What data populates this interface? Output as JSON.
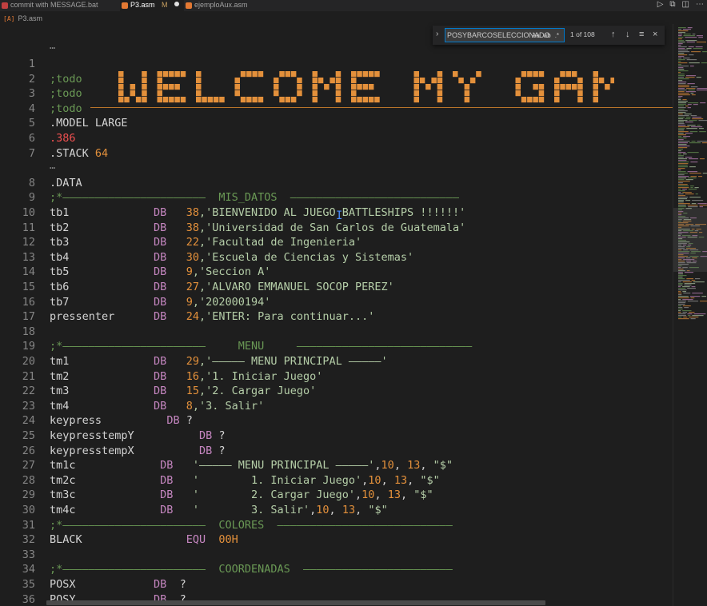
{
  "tabs": [
    {
      "label": "commit with MESSAGE.bat",
      "active": false
    },
    {
      "label": "P3.asm",
      "active": true,
      "modified": "M"
    },
    {
      "label": "ejemploAux.asm",
      "active": false
    }
  ],
  "breadcrumb": {
    "file": "P3.asm"
  },
  "find": {
    "query": "POSYBARCOSELECCIONADO",
    "match_case": "Aa",
    "whole_word": "ab",
    "regex": ".*",
    "count": "1 of 108"
  },
  "banner_text": "WELCOME MY GAME",
  "folds": {
    "top": "…",
    "after7": "…"
  },
  "lines": [
    {
      "n": "1",
      "tokens": []
    },
    {
      "n": "2",
      "tokens": [
        {
          "t": ";todo",
          "c": "c-cmt"
        }
      ]
    },
    {
      "n": "3",
      "tokens": [
        {
          "t": ";todo",
          "c": "c-cmt"
        }
      ]
    },
    {
      "n": "4",
      "tokens": [
        {
          "t": ";todo",
          "c": "c-cmt"
        }
      ]
    },
    {
      "n": "5",
      "tokens": [
        {
          "t": ".MODEL LARGE",
          "c": "c-plain"
        }
      ]
    },
    {
      "n": "6",
      "tokens": [
        {
          "t": ".386",
          "c": "c-red"
        }
      ]
    },
    {
      "n": "7",
      "tokens": [
        {
          "t": ".STACK ",
          "c": "c-plain"
        },
        {
          "t": "64",
          "c": "c-num"
        }
      ]
    },
    {
      "n": "8",
      "tokens": [
        {
          "t": ".DATA",
          "c": "c-plain"
        }
      ]
    },
    {
      "n": "9",
      "tokens": [
        {
          "t": ";*——————————————————————  MIS_DATOS  ——————————————————————————",
          "c": "c-cmt"
        }
      ]
    },
    {
      "n": "10",
      "tokens": [
        {
          "t": "tb1             ",
          "c": "c-plain"
        },
        {
          "t": "DB",
          "c": "c-kw"
        },
        {
          "t": "   ",
          "c": "c-plain"
        },
        {
          "t": "38",
          "c": "c-num"
        },
        {
          "t": ",'BIENVENIDO AL JUEGO BATTLESHIPS !!!!!!'",
          "c": "c-grn"
        }
      ]
    },
    {
      "n": "11",
      "tokens": [
        {
          "t": "tb2             ",
          "c": "c-plain"
        },
        {
          "t": "DB",
          "c": "c-kw"
        },
        {
          "t": "   ",
          "c": "c-plain"
        },
        {
          "t": "38",
          "c": "c-num"
        },
        {
          "t": ",'Universidad de San Carlos de Guatemala'",
          "c": "c-grn"
        }
      ]
    },
    {
      "n": "12",
      "tokens": [
        {
          "t": "tb3             ",
          "c": "c-plain"
        },
        {
          "t": "DB",
          "c": "c-kw"
        },
        {
          "t": "   ",
          "c": "c-plain"
        },
        {
          "t": "22",
          "c": "c-num"
        },
        {
          "t": ",'Facultad de Ingenieria'",
          "c": "c-grn"
        }
      ]
    },
    {
      "n": "13",
      "tokens": [
        {
          "t": "tb4             ",
          "c": "c-plain"
        },
        {
          "t": "DB",
          "c": "c-kw"
        },
        {
          "t": "   ",
          "c": "c-plain"
        },
        {
          "t": "30",
          "c": "c-num"
        },
        {
          "t": ",'Escuela de Ciencias y Sistemas'",
          "c": "c-grn"
        }
      ]
    },
    {
      "n": "14",
      "tokens": [
        {
          "t": "tb5             ",
          "c": "c-plain"
        },
        {
          "t": "DB",
          "c": "c-kw"
        },
        {
          "t": "   ",
          "c": "c-plain"
        },
        {
          "t": "9",
          "c": "c-num"
        },
        {
          "t": ",'Seccion A'",
          "c": "c-grn"
        }
      ]
    },
    {
      "n": "15",
      "tokens": [
        {
          "t": "tb6             ",
          "c": "c-plain"
        },
        {
          "t": "DB",
          "c": "c-kw"
        },
        {
          "t": "   ",
          "c": "c-plain"
        },
        {
          "t": "27",
          "c": "c-num"
        },
        {
          "t": ",'ALVARO EMMANUEL SOCOP PEREZ'",
          "c": "c-grn"
        }
      ]
    },
    {
      "n": "16",
      "tokens": [
        {
          "t": "tb7             ",
          "c": "c-plain"
        },
        {
          "t": "DB",
          "c": "c-kw"
        },
        {
          "t": "   ",
          "c": "c-plain"
        },
        {
          "t": "9",
          "c": "c-num"
        },
        {
          "t": ",'202000194'",
          "c": "c-grn"
        }
      ]
    },
    {
      "n": "17",
      "tokens": [
        {
          "t": "pressenter      ",
          "c": "c-plain"
        },
        {
          "t": "DB",
          "c": "c-kw"
        },
        {
          "t": "   ",
          "c": "c-plain"
        },
        {
          "t": "24",
          "c": "c-num"
        },
        {
          "t": ",'ENTER: Para continuar...'",
          "c": "c-grn"
        }
      ]
    },
    {
      "n": "18",
      "tokens": []
    },
    {
      "n": "19",
      "tokens": [
        {
          "t": ";*——————————————————————     MENU     ———————————————————————————",
          "c": "c-cmt"
        }
      ]
    },
    {
      "n": "20",
      "tokens": [
        {
          "t": "tm1             ",
          "c": "c-plain"
        },
        {
          "t": "DB",
          "c": "c-kw"
        },
        {
          "t": "   ",
          "c": "c-plain"
        },
        {
          "t": "29",
          "c": "c-num"
        },
        {
          "t": ",'————— MENU PRINCIPAL —————'",
          "c": "c-grn"
        }
      ]
    },
    {
      "n": "21",
      "tokens": [
        {
          "t": "tm2             ",
          "c": "c-plain"
        },
        {
          "t": "DB",
          "c": "c-kw"
        },
        {
          "t": "   ",
          "c": "c-plain"
        },
        {
          "t": "16",
          "c": "c-num"
        },
        {
          "t": ",'1. Iniciar Juego'",
          "c": "c-grn"
        }
      ]
    },
    {
      "n": "22",
      "tokens": [
        {
          "t": "tm3             ",
          "c": "c-plain"
        },
        {
          "t": "DB",
          "c": "c-kw"
        },
        {
          "t": "   ",
          "c": "c-plain"
        },
        {
          "t": "15",
          "c": "c-num"
        },
        {
          "t": ",'2. Cargar Juego'",
          "c": "c-grn"
        }
      ]
    },
    {
      "n": "23",
      "tokens": [
        {
          "t": "tm4             ",
          "c": "c-plain"
        },
        {
          "t": "DB",
          "c": "c-kw"
        },
        {
          "t": "   ",
          "c": "c-plain"
        },
        {
          "t": "8",
          "c": "c-num"
        },
        {
          "t": ",'3. Salir'",
          "c": "c-grn"
        }
      ]
    },
    {
      "n": "24",
      "tokens": [
        {
          "t": "keypress          ",
          "c": "c-plain"
        },
        {
          "t": "DB",
          "c": "c-kw"
        },
        {
          "t": " ?",
          "c": "c-plain"
        }
      ]
    },
    {
      "n": "25",
      "tokens": [
        {
          "t": "keypresstempY          ",
          "c": "c-plain"
        },
        {
          "t": "DB",
          "c": "c-kw"
        },
        {
          "t": " ?",
          "c": "c-plain"
        }
      ]
    },
    {
      "n": "26",
      "tokens": [
        {
          "t": "keypresstempX          ",
          "c": "c-plain"
        },
        {
          "t": "DB",
          "c": "c-kw"
        },
        {
          "t": " ?",
          "c": "c-plain"
        }
      ]
    },
    {
      "n": "27",
      "tokens": [
        {
          "t": "tm1c             ",
          "c": "c-plain"
        },
        {
          "t": "DB",
          "c": "c-kw"
        },
        {
          "t": "   ",
          "c": "c-plain"
        },
        {
          "t": "'————— MENU PRINCIPAL —————'",
          "c": "c-grn"
        },
        {
          "t": ",",
          "c": "c-plain"
        },
        {
          "t": "10",
          "c": "c-num"
        },
        {
          "t": ", ",
          "c": "c-plain"
        },
        {
          "t": "13",
          "c": "c-num"
        },
        {
          "t": ", ",
          "c": "c-plain"
        },
        {
          "t": "\"$\"",
          "c": "c-grn"
        }
      ]
    },
    {
      "n": "28",
      "tokens": [
        {
          "t": "tm2c             ",
          "c": "c-plain"
        },
        {
          "t": "DB",
          "c": "c-kw"
        },
        {
          "t": "   ",
          "c": "c-plain"
        },
        {
          "t": "'        1. Iniciar Juego'",
          "c": "c-grn"
        },
        {
          "t": ",",
          "c": "c-plain"
        },
        {
          "t": "10",
          "c": "c-num"
        },
        {
          "t": ", ",
          "c": "c-plain"
        },
        {
          "t": "13",
          "c": "c-num"
        },
        {
          "t": ", ",
          "c": "c-plain"
        },
        {
          "t": "\"$\"",
          "c": "c-grn"
        }
      ]
    },
    {
      "n": "29",
      "tokens": [
        {
          "t": "tm3c             ",
          "c": "c-plain"
        },
        {
          "t": "DB",
          "c": "c-kw"
        },
        {
          "t": "   ",
          "c": "c-plain"
        },
        {
          "t": "'        2. Cargar Juego'",
          "c": "c-grn"
        },
        {
          "t": ",",
          "c": "c-plain"
        },
        {
          "t": "10",
          "c": "c-num"
        },
        {
          "t": ", ",
          "c": "c-plain"
        },
        {
          "t": "13",
          "c": "c-num"
        },
        {
          "t": ", ",
          "c": "c-plain"
        },
        {
          "t": "\"$\"",
          "c": "c-grn"
        }
      ]
    },
    {
      "n": "30",
      "tokens": [
        {
          "t": "tm4c             ",
          "c": "c-plain"
        },
        {
          "t": "DB",
          "c": "c-kw"
        },
        {
          "t": "   ",
          "c": "c-plain"
        },
        {
          "t": "'        3. Salir'",
          "c": "c-grn"
        },
        {
          "t": ",",
          "c": "c-plain"
        },
        {
          "t": "10",
          "c": "c-num"
        },
        {
          "t": ", ",
          "c": "c-plain"
        },
        {
          "t": "13",
          "c": "c-num"
        },
        {
          "t": ", ",
          "c": "c-plain"
        },
        {
          "t": "\"$\"",
          "c": "c-grn"
        }
      ]
    },
    {
      "n": "31",
      "tokens": [
        {
          "t": ";*——————————————————————  COLORES  ———————————————————————————",
          "c": "c-cmt"
        }
      ]
    },
    {
      "n": "32",
      "tokens": [
        {
          "t": "BLACK                ",
          "c": "c-plain"
        },
        {
          "t": "EQU",
          "c": "c-kw"
        },
        {
          "t": "  ",
          "c": "c-plain"
        },
        {
          "t": "00H",
          "c": "c-num"
        }
      ]
    },
    {
      "n": "33",
      "tokens": []
    },
    {
      "n": "34",
      "tokens": [
        {
          "t": ";*——————————————————————  COORDENADAS  ———————————————————————",
          "c": "c-cmt"
        }
      ]
    },
    {
      "n": "35",
      "tokens": [
        {
          "t": "POSX            ",
          "c": "c-plain"
        },
        {
          "t": "DB",
          "c": "c-kw"
        },
        {
          "t": "  ?",
          "c": "c-plain"
        }
      ]
    },
    {
      "n": "36",
      "tokens": [
        {
          "t": "POSY            ",
          "c": "c-plain"
        },
        {
          "t": "DB",
          "c": "c-kw"
        },
        {
          "t": "  ?",
          "c": "c-plain"
        }
      ]
    }
  ],
  "colors": {
    "accent": "#007acc",
    "banner": "#e3903b",
    "comment": "#6a9955",
    "keyword": "#c586c0",
    "number": "#e3903b",
    "string": "#b5cea8"
  }
}
